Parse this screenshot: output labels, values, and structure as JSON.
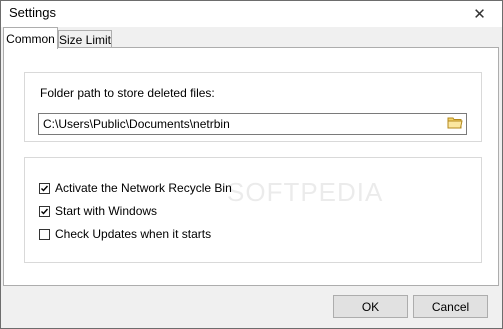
{
  "window": {
    "title": "Settings",
    "close_glyph": "✕"
  },
  "tabs": [
    {
      "label": "Common"
    },
    {
      "label": "Size Limit"
    }
  ],
  "common": {
    "folder_label": "Folder path to store deleted files:",
    "folder_path": "C:\\Users\\Public\\Documents\\netrbin",
    "checkboxes": [
      {
        "label": "Activate the Network Recycle Bin",
        "checked": true
      },
      {
        "label": "Start with Windows",
        "checked": true
      },
      {
        "label": "Check Updates when it starts",
        "checked": false
      }
    ]
  },
  "buttons": {
    "ok": "OK",
    "cancel": "Cancel"
  },
  "watermark": "SOFTPEDIA",
  "icons": {
    "browse": "folder-icon",
    "close": "close-icon",
    "check": "checkmark-icon"
  }
}
